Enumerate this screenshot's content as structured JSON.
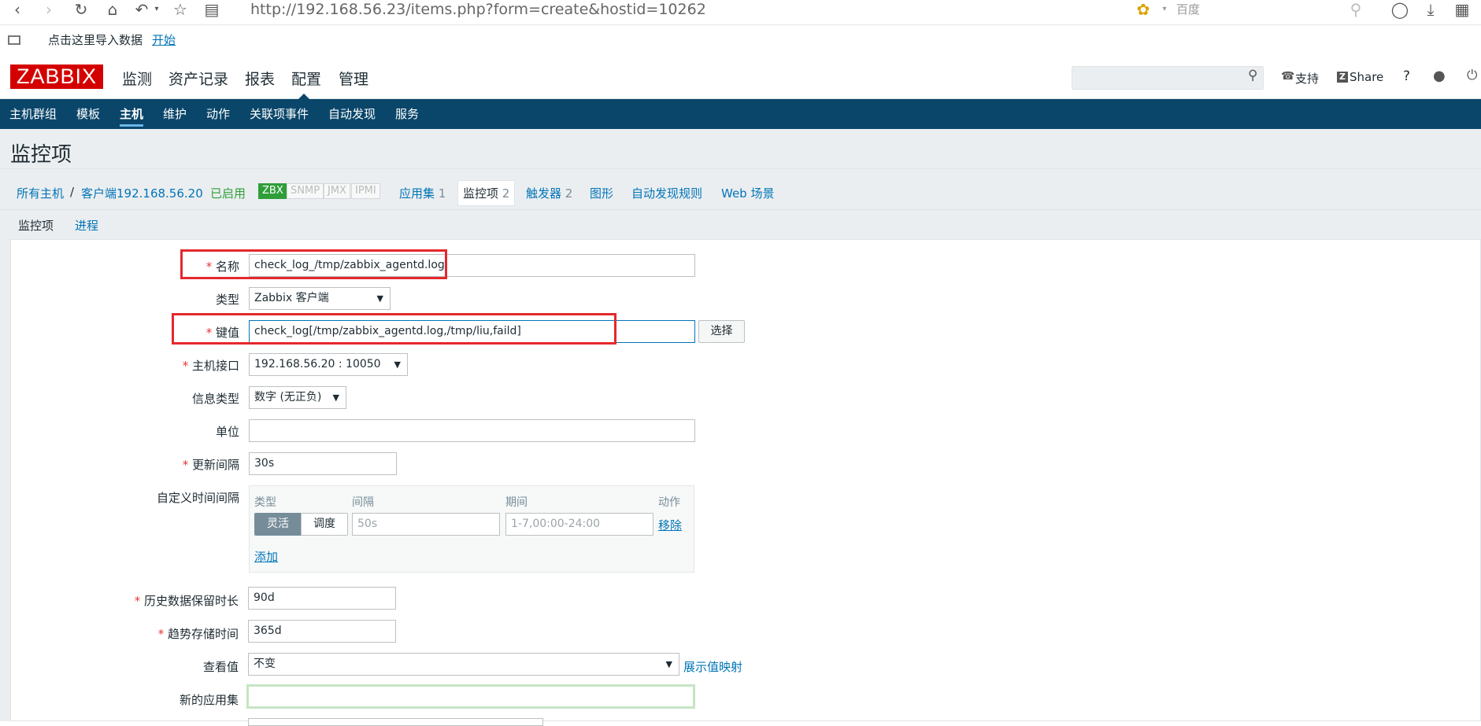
{
  "browser": {
    "url": "http://192.168.56.23/items.php?form=create&hostid=10262",
    "search_placeholder": "百度",
    "bookmark_text": "点击这里导入数据",
    "bookmark_link": "开始"
  },
  "header": {
    "logo": "ZABBIX",
    "menu": [
      "监测",
      "资产记录",
      "报表",
      "配置",
      "管理"
    ],
    "support": "支持",
    "share": "Share",
    "help": "?"
  },
  "subnav": [
    "主机群组",
    "模板",
    "主机",
    "维护",
    "动作",
    "关联项事件",
    "自动发现",
    "服务"
  ],
  "page": {
    "title": "监控项",
    "breadcrumb_all": "所有主机",
    "breadcrumb_sep": "/",
    "breadcrumb_host": "客户端192.168.56.20",
    "status": "已启用",
    "badges": [
      "ZBX",
      "SNMP",
      "JMX",
      "IPMI"
    ],
    "hostlinks": [
      {
        "label": "应用集",
        "count": "1"
      },
      {
        "label": "监控项",
        "count": "2"
      },
      {
        "label": "触发器",
        "count": "2"
      },
      {
        "label": "图形",
        "count": ""
      },
      {
        "label": "自动发现规则",
        "count": ""
      },
      {
        "label": "Web 场景",
        "count": ""
      }
    ],
    "tabs": [
      "监控项",
      "进程"
    ]
  },
  "form": {
    "name_label": "名称",
    "name_value": "check_log_/tmp/zabbix_agentd.log",
    "type_label": "类型",
    "type_value": "Zabbix 客户端",
    "key_label": "键值",
    "key_value": "check_log[/tmp/zabbix_agentd.log,/tmp/liu,faild]",
    "key_button": "选择",
    "interface_label": "主机接口",
    "interface_value": "192.168.56.20 : 10050",
    "info_type_label": "信息类型",
    "info_type_value": "数字 (无正负)",
    "units_label": "单位",
    "units_value": "",
    "update_label": "更新间隔",
    "update_value": "30s",
    "custom_label": "自定义时间间隔",
    "custom_headers": [
      "类型",
      "间隔",
      "期间",
      "动作"
    ],
    "custom_type_flexible": "灵活",
    "custom_type_scheduling": "调度",
    "custom_interval_placeholder": "50s",
    "custom_period_placeholder": "1-7,00:00-24:00",
    "custom_remove": "移除",
    "custom_add": "添加",
    "history_label": "历史数据保留时长",
    "history_value": "90d",
    "trends_label": "趋势存储时间",
    "trends_value": "365d",
    "valuemap_label": "查看值",
    "valuemap_value": "不变",
    "valuemap_link": "展示值映射",
    "newapp_label": "新的应用集",
    "newapp_value": ""
  },
  "colors": {
    "accent": "#0275b8",
    "nav_bg": "#0a466a",
    "logo_bg": "#d40000",
    "highlight_box": "#e5282c",
    "status_green": "#2f9e39"
  }
}
